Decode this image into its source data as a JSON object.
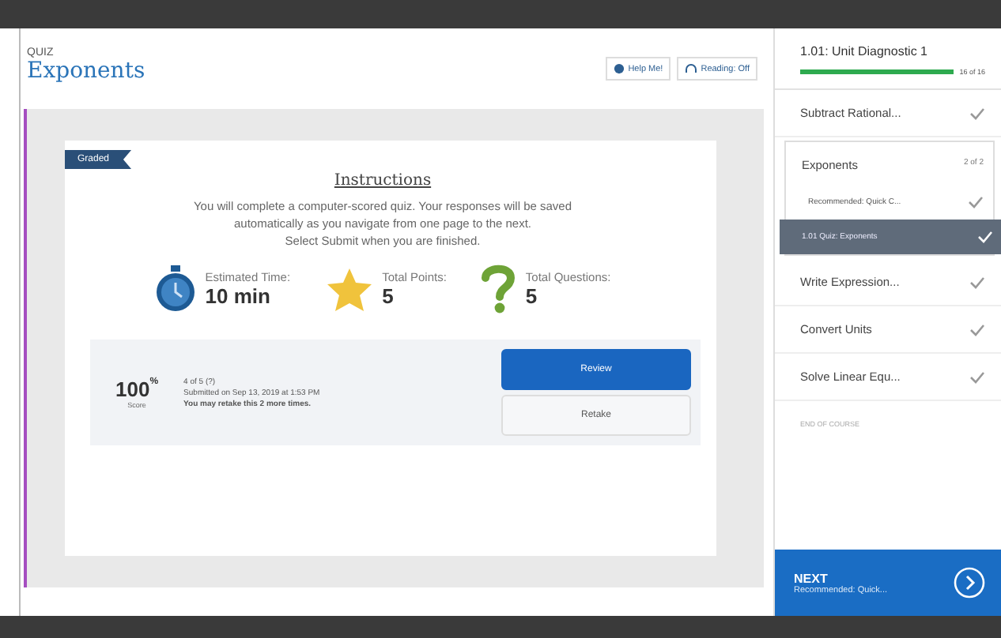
{
  "header": {
    "eyebrow": "QUIZ",
    "title": "Exponents",
    "buttons": [
      {
        "label": "Help Me!"
      },
      {
        "label": "Reading: Off"
      }
    ]
  },
  "card": {
    "badge": "Graded",
    "heading": "Instructions",
    "lines": [
      "You will complete a computer-scored quiz. Your responses will be saved",
      "automatically as you navigate from one page to the next.",
      "Select Submit when you are finished."
    ],
    "stats": [
      {
        "label": "Estimated Time:",
        "value": "10 min"
      },
      {
        "label": "Total Points:",
        "value": "5"
      },
      {
        "label": "Total Questions:",
        "value": "5"
      }
    ],
    "result": {
      "score": "100",
      "unit": "%",
      "score_label": "Score",
      "lines": [
        "4 of 5 (?)",
        "Submitted on Sep 13, 2019 at 1:53 PM",
        "You may retake this 2 more times."
      ],
      "buttons": [
        {
          "label": "Review",
          "primary": true
        },
        {
          "label": "Retake",
          "primary": false
        }
      ]
    }
  },
  "sidebar": {
    "title": "1.01: Unit Diagnostic 1",
    "level": 1,
    "progress_text": "16 of 16",
    "items": [
      {
        "kind": "item",
        "label": "Subtract Rational...",
        "done": true
      },
      {
        "kind": "group",
        "label": "Exponents",
        "count": "2 of 2",
        "children": [
          {
            "label": "Recommended: Quick C...",
            "done": true,
            "selected": false
          },
          {
            "label": "1.01 Quiz: Exponents",
            "done": true,
            "selected": true
          }
        ]
      },
      {
        "kind": "item",
        "label": "Write Expression...",
        "done": true
      },
      {
        "kind": "item",
        "label": "Convert Units",
        "done": true
      },
      {
        "kind": "item",
        "label": "Solve Linear Equ...",
        "done": true
      },
      {
        "kind": "end",
        "label": "END OF COURSE"
      }
    ],
    "next": {
      "label": "NEXT",
      "sub": "Recommended: Quick..."
    }
  }
}
